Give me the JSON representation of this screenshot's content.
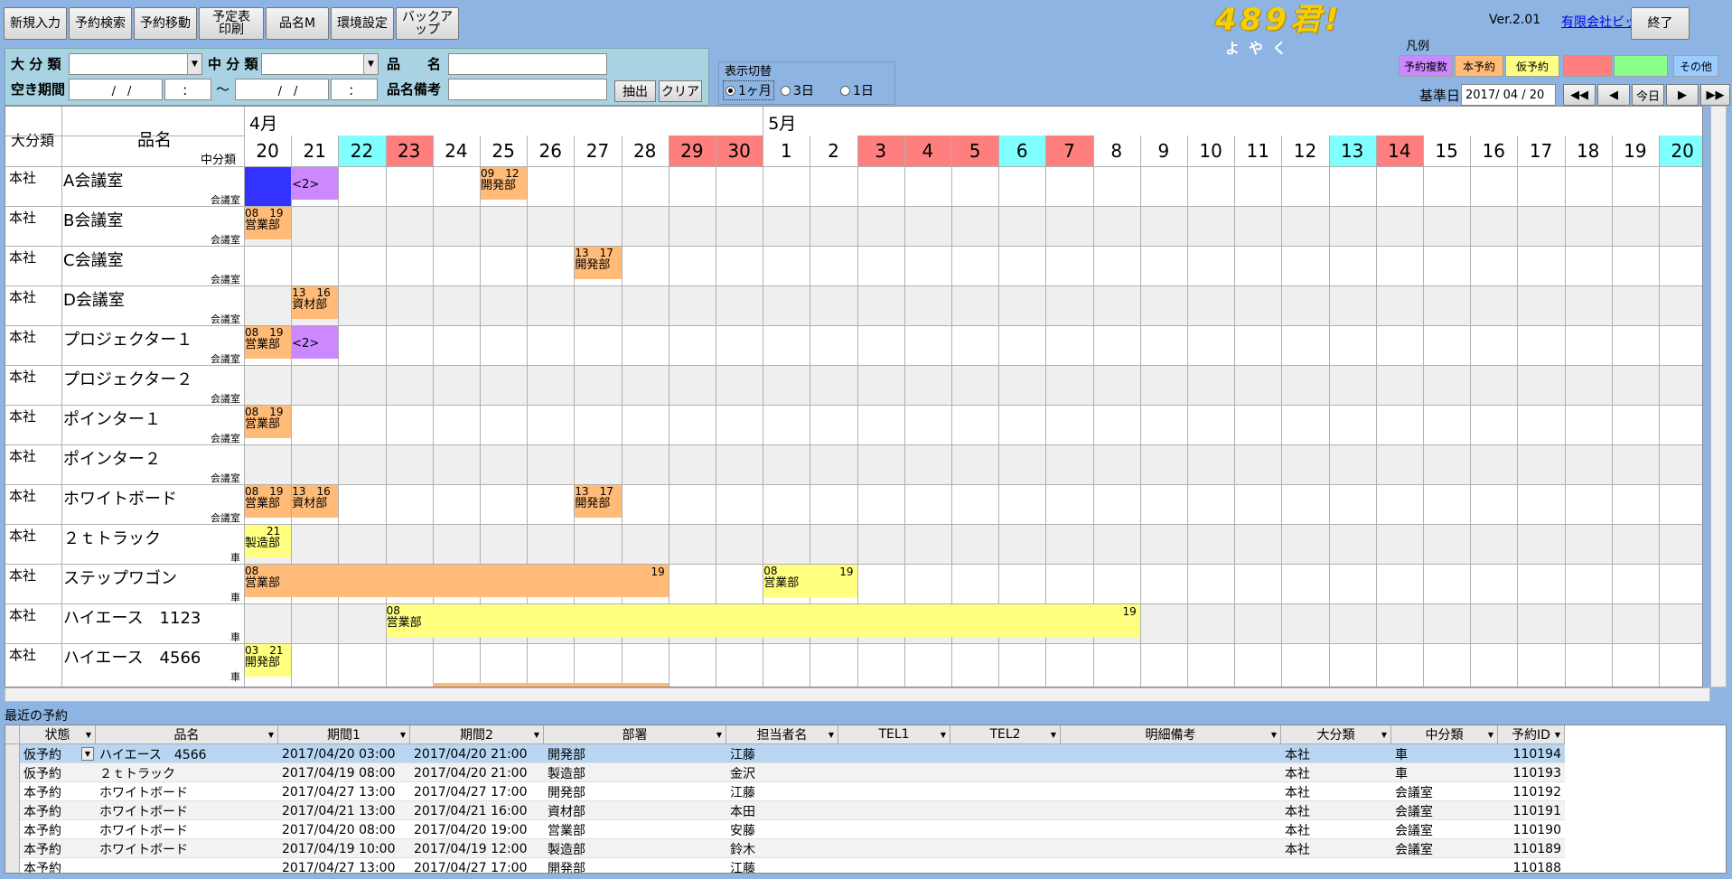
{
  "toolbar": {
    "buttons": [
      "新規入力",
      "予約検索",
      "予約移動",
      "予定表\n印刷",
      "品名M",
      "環境設定",
      "バックアップ"
    ]
  },
  "logo": {
    "main": "489君!",
    "sub": "よやく"
  },
  "version": "Ver.2.01",
  "company": "有限会社ビット",
  "exit_label": "終了",
  "legend": {
    "title": "凡例",
    "items": [
      {
        "label": "予約複数",
        "color": "#cc88ff"
      },
      {
        "label": "本予約",
        "color": "#ffbb77"
      },
      {
        "label": "仮予約",
        "color": "#ffff88"
      },
      {
        "label": "",
        "color": "#ff7f7f"
      },
      {
        "label": "",
        "color": "#88ff88"
      },
      {
        "label": "その他",
        "color": "#99ccff"
      }
    ]
  },
  "search": {
    "daibunrui_label": "大 分 類",
    "chubunrui_label": "中 分 類",
    "hinmei_label": "品　　名",
    "akikikan_label": "空き期間",
    "hinmei_biko_label": "品名備考",
    "date_from": "　/　/",
    "time_from": "：",
    "tilde": "～",
    "date_to": "　/　/",
    "time_to": "：",
    "extract_label": "抽出",
    "clear_label": "クリア"
  },
  "view_switch": {
    "title": "表示切替",
    "options": [
      "1ヶ月",
      "3日",
      "1日"
    ],
    "selected": "1ヶ月"
  },
  "base_date": {
    "label": "基準日",
    "value": "2017/ 04 / 20"
  },
  "nav": {
    "first": "◀◀",
    "prev": "◀",
    "today": "今日",
    "next": "▶",
    "last": "▶▶"
  },
  "grid": {
    "header_daibunrui": "大分類",
    "header_hinmei": "品名",
    "header_chubunrui": "中分類",
    "months": [
      {
        "label": "4月",
        "col": 0
      },
      {
        "label": "5月",
        "col": 11
      }
    ],
    "days": [
      {
        "d": "20",
        "c": "w"
      },
      {
        "d": "21",
        "c": "w"
      },
      {
        "d": "22",
        "c": "c"
      },
      {
        "d": "23",
        "c": "r"
      },
      {
        "d": "24",
        "c": "w"
      },
      {
        "d": "25",
        "c": "w"
      },
      {
        "d": "26",
        "c": "w"
      },
      {
        "d": "27",
        "c": "w"
      },
      {
        "d": "28",
        "c": "w"
      },
      {
        "d": "29",
        "c": "r"
      },
      {
        "d": "30",
        "c": "r"
      },
      {
        "d": "1",
        "c": "w"
      },
      {
        "d": "2",
        "c": "w"
      },
      {
        "d": "3",
        "c": "r"
      },
      {
        "d": "4",
        "c": "r"
      },
      {
        "d": "5",
        "c": "r"
      },
      {
        "d": "6",
        "c": "c"
      },
      {
        "d": "7",
        "c": "r"
      },
      {
        "d": "8",
        "c": "w"
      },
      {
        "d": "9",
        "c": "w"
      },
      {
        "d": "10",
        "c": "w"
      },
      {
        "d": "11",
        "c": "w"
      },
      {
        "d": "12",
        "c": "w"
      },
      {
        "d": "13",
        "c": "c"
      },
      {
        "d": "14",
        "c": "r"
      },
      {
        "d": "15",
        "c": "w"
      },
      {
        "d": "16",
        "c": "w"
      },
      {
        "d": "17",
        "c": "w"
      },
      {
        "d": "18",
        "c": "w"
      },
      {
        "d": "19",
        "c": "w"
      },
      {
        "d": "20",
        "c": "c"
      }
    ],
    "rows": [
      {
        "cat": "本社",
        "name": "A会議室",
        "sub": "会議室"
      },
      {
        "cat": "本社",
        "name": "B会議室",
        "sub": "会議室"
      },
      {
        "cat": "本社",
        "name": "C会議室",
        "sub": "会議室"
      },
      {
        "cat": "本社",
        "name": "D会議室",
        "sub": "会議室"
      },
      {
        "cat": "本社",
        "name": "プロジェクター１",
        "sub": "会議室"
      },
      {
        "cat": "本社",
        "name": "プロジェクター２",
        "sub": "会議室"
      },
      {
        "cat": "本社",
        "name": "ポインター１",
        "sub": "会議室"
      },
      {
        "cat": "本社",
        "name": "ポインター２",
        "sub": "会議室"
      },
      {
        "cat": "本社",
        "name": "ホワイトボード",
        "sub": "会議室"
      },
      {
        "cat": "本社",
        "name": "２ｔトラック",
        "sub": "車"
      },
      {
        "cat": "本社",
        "name": "ステップワゴン",
        "sub": "車"
      },
      {
        "cat": "本社",
        "name": "ハイエース　1123",
        "sub": "車"
      },
      {
        "cat": "本社",
        "name": "ハイエース　4566",
        "sub": "車"
      }
    ],
    "bookings": [
      {
        "row": 0,
        "start": 0,
        "span": 1,
        "type": "selected",
        "t1": "",
        "t2": "",
        "end": ""
      },
      {
        "row": 0,
        "start": 1,
        "span": 1,
        "type": "multi",
        "t1": "",
        "t2": "<2>",
        "end": ""
      },
      {
        "row": 0,
        "start": 5,
        "span": 1,
        "type": "hon",
        "t1": "09　12",
        "t2": "開発部",
        "end": ""
      },
      {
        "row": 1,
        "start": 0,
        "span": 1,
        "type": "hon",
        "t1": "08　19",
        "t2": "営業部",
        "end": ""
      },
      {
        "row": 2,
        "start": 7,
        "span": 1,
        "type": "hon",
        "t1": "13　17",
        "t2": "開発部",
        "end": ""
      },
      {
        "row": 3,
        "start": 1,
        "span": 1,
        "type": "hon",
        "t1": "13　16",
        "t2": "資材部",
        "end": ""
      },
      {
        "row": 4,
        "start": 0,
        "span": 1,
        "type": "hon",
        "t1": "08　19",
        "t2": "営業部",
        "end": ""
      },
      {
        "row": 4,
        "start": 1,
        "span": 1,
        "type": "multi",
        "t1": "",
        "t2": "<2>",
        "end": ""
      },
      {
        "row": 6,
        "start": 0,
        "span": 1,
        "type": "hon",
        "t1": "08　19",
        "t2": "営業部",
        "end": ""
      },
      {
        "row": 8,
        "start": 0,
        "span": 1,
        "type": "hon",
        "t1": "08　19",
        "t2": "営業部",
        "end": ""
      },
      {
        "row": 8,
        "start": 1,
        "span": 1,
        "type": "hon",
        "t1": "13　16",
        "t2": "資材部",
        "end": ""
      },
      {
        "row": 8,
        "start": 7,
        "span": 1,
        "type": "hon",
        "t1": "13　17",
        "t2": "開発部",
        "end": ""
      },
      {
        "row": 9,
        "start": 0,
        "span": 1,
        "type": "kari",
        "t1": "　　21",
        "t2": "製造部",
        "end": ""
      },
      {
        "row": 10,
        "start": 0,
        "span": 9,
        "type": "hon",
        "t1": "08",
        "t2": "営業部",
        "end": "19"
      },
      {
        "row": 10,
        "start": 11,
        "span": 2,
        "type": "kari",
        "t1": "08",
        "t2": "営業部",
        "end": "19"
      },
      {
        "row": 11,
        "start": 3,
        "span": 16,
        "type": "kari",
        "t1": "08",
        "t2": "営業部",
        "end": "19"
      },
      {
        "row": 12,
        "start": 0,
        "span": 1,
        "type": "kari",
        "t1": "03　21",
        "t2": "開発部",
        "end": ""
      }
    ]
  },
  "recent": {
    "title": "最近の予約",
    "columns": [
      "状態",
      "品名",
      "期間1",
      "期間2",
      "部署",
      "担当者名",
      "TEL1",
      "TEL2",
      "明細備考",
      "大分類",
      "中分類",
      "予約ID"
    ],
    "rows": [
      [
        "仮予約",
        "ハイエース　4566",
        "2017/04/20 03:00",
        "2017/04/20 21:00",
        "開発部",
        "江藤",
        "",
        "",
        "",
        "本社",
        "車",
        "110194"
      ],
      [
        "仮予約",
        "２ｔトラック",
        "2017/04/19 08:00",
        "2017/04/20 21:00",
        "製造部",
        "金沢",
        "",
        "",
        "",
        "本社",
        "車",
        "110193"
      ],
      [
        "本予約",
        "ホワイトボード",
        "2017/04/27 13:00",
        "2017/04/27 17:00",
        "開発部",
        "江藤",
        "",
        "",
        "",
        "本社",
        "会議室",
        "110192"
      ],
      [
        "本予約",
        "ホワイトボード",
        "2017/04/21 13:00",
        "2017/04/21 16:00",
        "資材部",
        "本田",
        "",
        "",
        "",
        "本社",
        "会議室",
        "110191"
      ],
      [
        "本予約",
        "ホワイトボード",
        "2017/04/20 08:00",
        "2017/04/20 19:00",
        "営業部",
        "安藤",
        "",
        "",
        "",
        "本社",
        "会議室",
        "110190"
      ],
      [
        "本予約",
        "ホワイトボード",
        "2017/04/19 10:00",
        "2017/04/19 12:00",
        "製造部",
        "鈴木",
        "",
        "",
        "",
        "本社",
        "会議室",
        "110189"
      ],
      [
        "本予約",
        "",
        "2017/04/27 13:00",
        "2017/04/27 17:00",
        "開発部",
        "江藤",
        "",
        "",
        "",
        "",
        "",
        "110188"
      ]
    ]
  },
  "colors": {
    "weekday": "#ffffff",
    "sunday": "#ff7f7f",
    "saturday": "#80ffff",
    "hon": "#ffbb77",
    "kari": "#ffff80",
    "multi": "#cc88ff",
    "selected": "#3333ff"
  }
}
